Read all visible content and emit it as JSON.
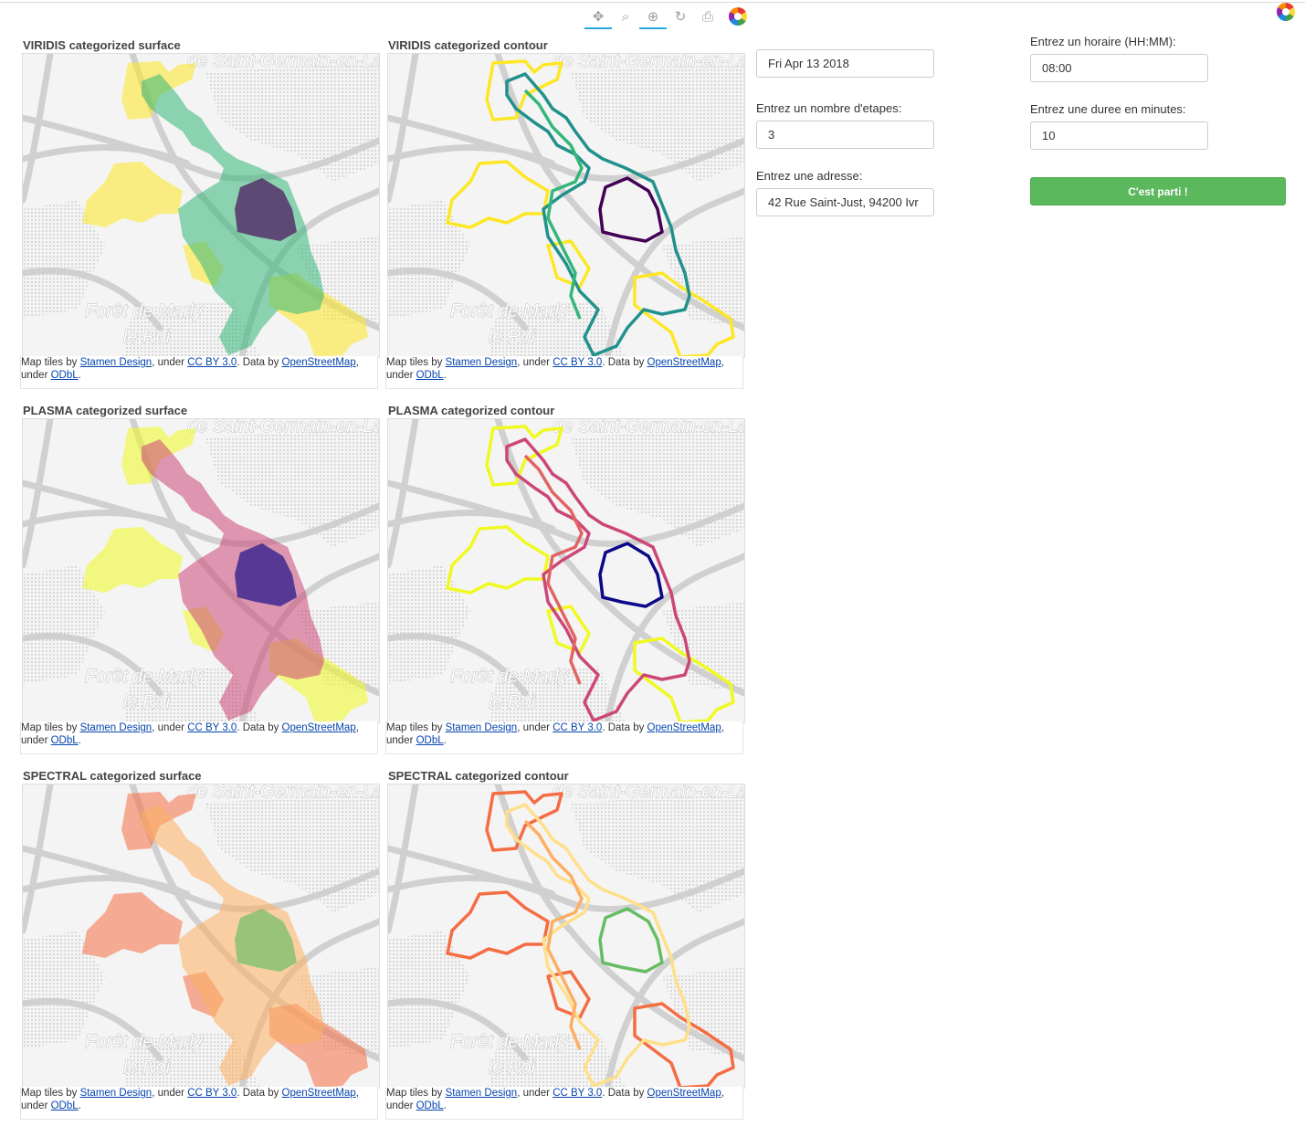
{
  "toolbar": {
    "tools": [
      {
        "name": "pan-tool-icon",
        "glyph": "✥",
        "active": true
      },
      {
        "name": "box-zoom-tool-icon",
        "glyph": "⌕",
        "active": false
      },
      {
        "name": "wheel-zoom-tool-icon",
        "glyph": "⊕",
        "active": true
      },
      {
        "name": "reset-tool-icon",
        "glyph": "↻",
        "active": false
      },
      {
        "name": "save-tool-icon",
        "glyph": "⎙",
        "active": false
      }
    ]
  },
  "attribution": {
    "prefix": "Map tiles by ",
    "stamen": "Stamen Design",
    "under1": ", under ",
    "ccby": "CC BY 3.0",
    "databy": ". Data by ",
    "osm": "OpenStreetMap",
    "under2": ", under ",
    "odbl": "ODbL",
    "end": "."
  },
  "map_labels": {
    "top": "de Saint-Germain-en-Lay",
    "forest1": "Forêt de Marly",
    "forest2": "le Roi"
  },
  "panels": [
    {
      "title": "VIRIDIS categorized surface",
      "mode": "surface",
      "colors": [
        "#fde725",
        "#35b779",
        "#31688e",
        "#440154"
      ]
    },
    {
      "title": "VIRIDIS categorized contour",
      "mode": "contour",
      "colors": [
        "#fde725",
        "#21918c",
        "#35b779",
        "#440154"
      ]
    },
    {
      "title": "PLASMA categorized surface",
      "mode": "surface",
      "colors": [
        "#f0f921",
        "#cc4778",
        "#e16462",
        "#0d0887"
      ]
    },
    {
      "title": "PLASMA categorized contour",
      "mode": "contour",
      "colors": [
        "#f0f921",
        "#cc4778",
        "#e16462",
        "#0d0887"
      ]
    },
    {
      "title": "SPECTRAL categorized surface",
      "mode": "surface",
      "colors": [
        "#f46d43",
        "#fdae61",
        "#fee08b",
        "#66bd63"
      ]
    },
    {
      "title": "SPECTRAL categorized contour",
      "mode": "contour",
      "colors": [
        "#f46d43",
        "#fee08b",
        "#fdae61",
        "#66bd63"
      ]
    }
  ],
  "form": {
    "date_value": "Fri Apr 13 2018",
    "steps_label": "Entrez un nombre d'etapes:",
    "steps_value": "3",
    "address_label": "Entrez une adresse:",
    "address_value": "42 Rue Saint-Just, 94200 Ivr",
    "time_label": "Entrez un horaire (HH:MM):",
    "time_value": "08:00",
    "duration_label": "Entrez une duree en minutes:",
    "duration_value": "10",
    "submit_label": "C'est parti !"
  }
}
